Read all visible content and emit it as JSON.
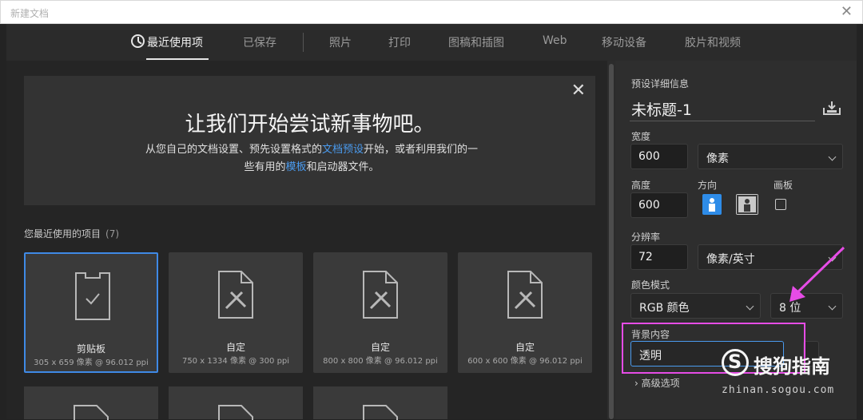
{
  "window": {
    "title": "新建文档",
    "close_icon": "close-icon"
  },
  "tabs": [
    {
      "label": "最近使用项",
      "active": true
    },
    {
      "label": "已保存"
    },
    {
      "label": "照片"
    },
    {
      "label": "打印"
    },
    {
      "label": "图稿和插图"
    },
    {
      "label": "Web"
    },
    {
      "label": "移动设备"
    },
    {
      "label": "胶片和视频"
    }
  ],
  "welcome": {
    "title": "让我们开始尝试新事物吧。",
    "line1_a": "从您自己的文档设置、预先设置格式的",
    "line1_link": "文档预设",
    "line1_b": "开始，或者利用我们的一",
    "line2_a": "些有用的",
    "line2_link": "模板",
    "line2_b": "和启动器文件。"
  },
  "recent": {
    "label": "您最近使用的项目",
    "count": "(7)",
    "items": [
      {
        "name": "剪贴板",
        "meta": "305 x 659 像素 @ 96.012 ppi",
        "icon": "clipboard-icon",
        "selected": true
      },
      {
        "name": "自定",
        "meta": "750 x 1334 像素 @ 300 ppi",
        "icon": "custom-document-icon"
      },
      {
        "name": "自定",
        "meta": "800 x 800 像素 @ 96.012 ppi",
        "icon": "custom-document-icon"
      },
      {
        "name": "自定",
        "meta": "600 x 600 像素 @ 96.012 ppi",
        "icon": "custom-document-icon"
      }
    ]
  },
  "preset": {
    "section_label": "预设详细信息",
    "doc_title": "未标题-1",
    "width_label": "宽度",
    "width_value": "600",
    "width_unit": "像素",
    "height_label": "高度",
    "height_value": "600",
    "orientation_label": "方向",
    "artboard_label": "画板",
    "resolution_label": "分辨率",
    "resolution_value": "72",
    "resolution_unit": "像素/英寸",
    "color_mode_label": "颜色模式",
    "color_mode": "RGB 颜色",
    "bit_depth": "8 位",
    "background_label": "背景内容",
    "background_value": "透明",
    "advanced_label": "高级选项"
  },
  "watermark": {
    "brand": "搜狗指南",
    "domain": "zhinan.sogou.com"
  },
  "colors": {
    "accent": "#3f8ae6",
    "link": "#4a9bef",
    "highlight": "#e64ce6"
  }
}
